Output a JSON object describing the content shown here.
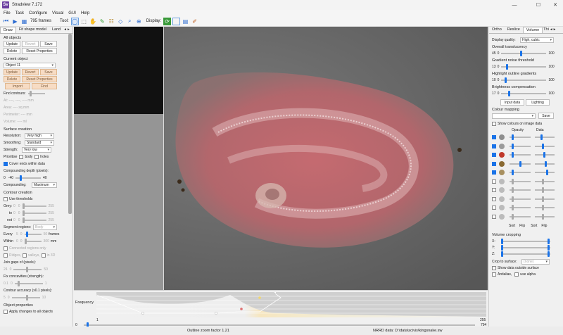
{
  "app": {
    "title": "Stradview 7.172",
    "logo": "Sv"
  },
  "menu": [
    "File",
    "Task",
    "Configure",
    "Visual",
    "GUI",
    "Help"
  ],
  "toolbar": {
    "frames": "795 frames",
    "tool_label": "Tool:",
    "display_label": "Display:"
  },
  "left": {
    "tabs": [
      "Draw",
      "Fit shape model",
      "Land"
    ],
    "all_objects": "All objects",
    "btn_update": "Update",
    "btn_revert": "Revert",
    "btn_save": "Save",
    "btn_delete": "Delete",
    "btn_reset": "Reset Properties",
    "current_object": "Current object",
    "object_selected": "Object 11",
    "btn_import": "Import",
    "btn_find": "Find",
    "find_contours": "Find contours:",
    "at": "At: ----, ----, ---- mm",
    "area": "Area: ---- sq mm",
    "perimeter": "Perimeter: ---- mm",
    "volume": "Volume: ---- ml",
    "surface_creation": "Surface creation",
    "resolution_label": "Resolution:",
    "resolution_value": "Very high",
    "smoothing_label": "Smoothing:",
    "smoothing_value": "Standard",
    "strength_label": "Strength:",
    "strength_value": "Very low",
    "prioritise": "Prioritise",
    "body": "body",
    "holes": "holes",
    "cover_ends": "Cover ends within data",
    "comp_depth": "Compounding depth (pixels):",
    "comp_min": "0",
    "comp_val": "-40",
    "comp_max": "40",
    "compounding_label": "Compounding:",
    "compounding_value": "Maximum",
    "contour_creation": "Contour creation",
    "use_thresholds": "Use thresholds",
    "grey": "Grey:",
    "to": "to",
    "not": "not",
    "v0": "0",
    "v255": "255",
    "segment_regions": "Segment regions:",
    "segment_value": "Body",
    "every": "Every",
    "within": "Within",
    "frames": "frames",
    "mm": "mm",
    "every_v1": "5",
    "every_v2": "0",
    "every_v3": "50",
    "within_v1": "0",
    "within_v2": "0",
    "within_v3": "300",
    "connected": "Connected regions only",
    "ridges": "Ridges,",
    "valleys": "valleys,",
    "in3d": "in 3D",
    "join_gaps": "Join gaps of (pixels):",
    "join_v1": "24",
    "join_v2": "0",
    "join_v3": "50",
    "fix_conc": "Fix concavities (strength):",
    "fix_v1": "0.1",
    "fix_v2": "0",
    "fix_v3": "1",
    "contour_acc": "Contour accuracy (x0.1 pixels):",
    "acc_v1": "5",
    "acc_v2": "0",
    "acc_v3": "10",
    "object_props": "Object properties",
    "apply_all": "Apply changes to all objects"
  },
  "histogram": {
    "label": "Frequency",
    "start": "1",
    "end": "255",
    "bottom_left": "0",
    "bottom_right": "794"
  },
  "status": {
    "zoom": "Outline zoom factor 1.21",
    "data": "NRRD data: D:\\data\\scivis\\kingsnake.sw"
  },
  "right": {
    "tabs": [
      "Ortho",
      "Reslice",
      "Volume",
      "Thi"
    ],
    "display_quality_label": "Display quality:",
    "display_quality_value": "High, cubic",
    "overall_trans": "Overall translucency",
    "ot_v": "45",
    "ot_min": "0",
    "ot_max": "100",
    "gradient_noise": "Gradient noise threshold",
    "gn_v": "13",
    "gn_min": "0",
    "gn_max": "100",
    "highlight": "Highlight outline gradients",
    "hl_v": "10",
    "hl_min": "0",
    "hl_max": "100",
    "brightness": "Brightness compensation",
    "br_v": "17",
    "br_min": "0",
    "br_max": "100",
    "btn_input": "Input data",
    "btn_lighting": "Lighting",
    "colour_mapping": "Colour mapping",
    "btn_save": "Save",
    "show_colours": "Show colours on image data",
    "opacity": "Opacity",
    "data": "Data",
    "sort": "Sort",
    "flip": "Flip",
    "volume_cropping": "Volume cropping",
    "x": "X:",
    "y": "Y:",
    "z": "Z:",
    "crop_surface": "Crop to surface:",
    "crop_value": "(none)",
    "show_outside": "Show data outside surface",
    "antialias": "Antialias,",
    "use_alpha": "use alpha",
    "swatches": [
      "#8e8e8e",
      "#9a9a9a",
      "#c0392b",
      "#8a6a33",
      "#a89060",
      "#bbbbbb",
      "#bbbbbb",
      "#bbbbbb",
      "#bbbbbb",
      "#bbbbbb"
    ]
  }
}
